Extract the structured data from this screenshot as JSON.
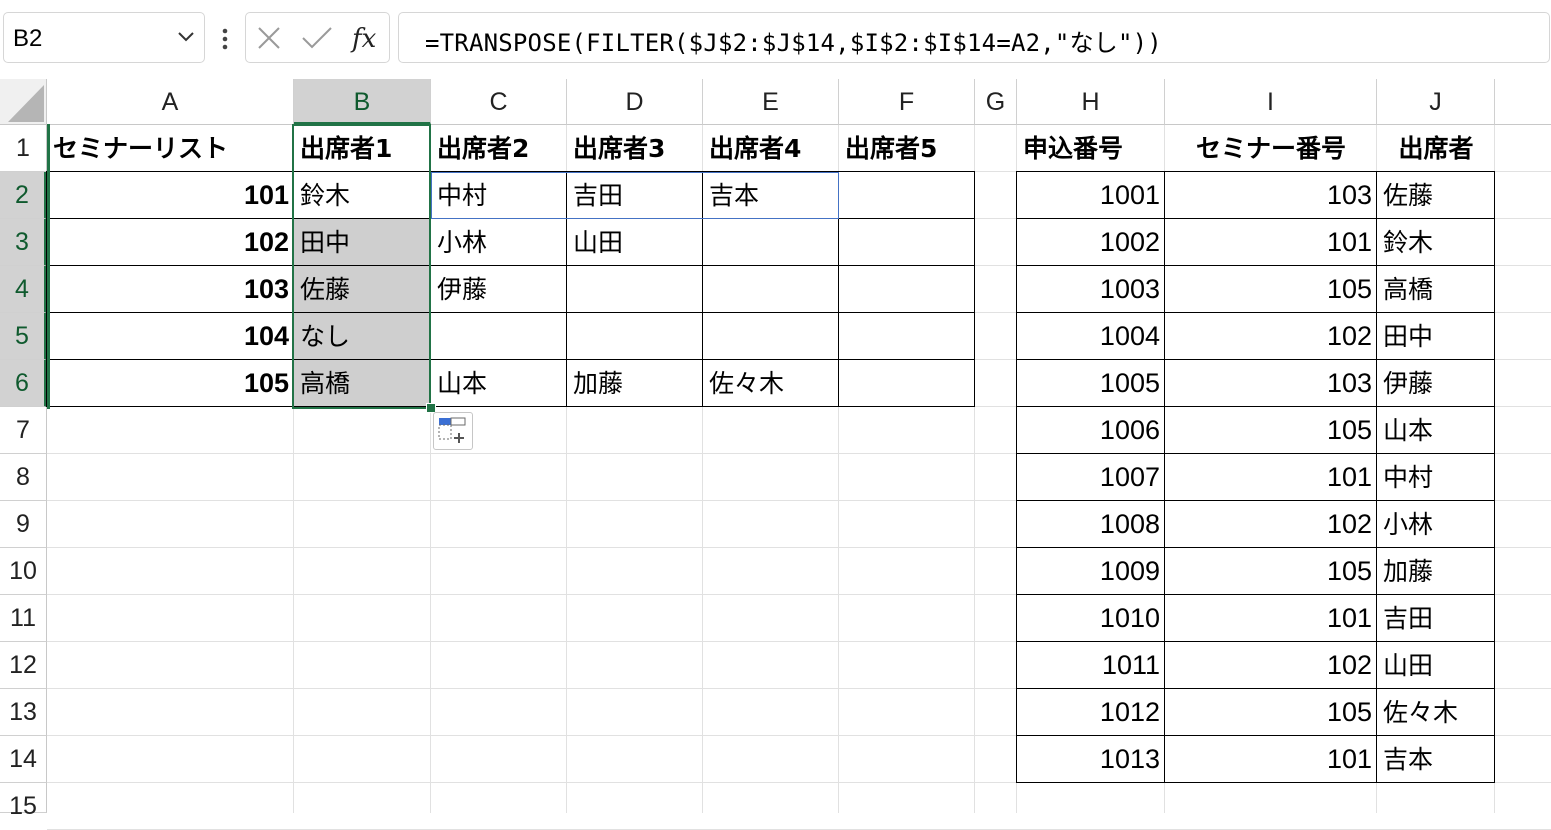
{
  "formula_bar": {
    "name_box": "B2",
    "formula": "=TRANSPOSE(FILTER($J$2:$J$14,$I$2:$I$14=A2,\"なし\"))"
  },
  "columns": [
    "A",
    "B",
    "C",
    "D",
    "E",
    "F",
    "G",
    "H",
    "I",
    "J"
  ],
  "rows": [
    "1",
    "2",
    "3",
    "4",
    "5",
    "6",
    "7",
    "8",
    "9",
    "10",
    "11",
    "12",
    "13",
    "14",
    "15"
  ],
  "table1": {
    "headers": [
      "セミナーリスト",
      "出席者1",
      "出席者2",
      "出席者3",
      "出席者4",
      "出席者5"
    ],
    "rows": [
      {
        "seminar": "101",
        "attendees": [
          "鈴木",
          "中村",
          "吉田",
          "吉本",
          ""
        ]
      },
      {
        "seminar": "102",
        "attendees": [
          "田中",
          "小林",
          "山田",
          "",
          ""
        ]
      },
      {
        "seminar": "103",
        "attendees": [
          "佐藤",
          "伊藤",
          "",
          "",
          ""
        ]
      },
      {
        "seminar": "104",
        "attendees": [
          "なし",
          "",
          "",
          "",
          ""
        ]
      },
      {
        "seminar": "105",
        "attendees": [
          "高橋",
          "山本",
          "加藤",
          "佐々木",
          ""
        ]
      }
    ]
  },
  "table2": {
    "headers": [
      "申込番号",
      "セミナー番号",
      "出席者"
    ],
    "rows": [
      [
        "1001",
        "103",
        "佐藤"
      ],
      [
        "1002",
        "101",
        "鈴木"
      ],
      [
        "1003",
        "105",
        "高橋"
      ],
      [
        "1004",
        "102",
        "田中"
      ],
      [
        "1005",
        "103",
        "伊藤"
      ],
      [
        "1006",
        "105",
        "山本"
      ],
      [
        "1007",
        "101",
        "中村"
      ],
      [
        "1008",
        "102",
        "小林"
      ],
      [
        "1009",
        "105",
        "加藤"
      ],
      [
        "1010",
        "101",
        "吉田"
      ],
      [
        "1011",
        "102",
        "山田"
      ],
      [
        "1012",
        "105",
        "佐々木"
      ],
      [
        "1013",
        "101",
        "吉本"
      ]
    ]
  },
  "colors": {
    "selection_green": "#217346",
    "spill_blue": "#4472c4"
  }
}
